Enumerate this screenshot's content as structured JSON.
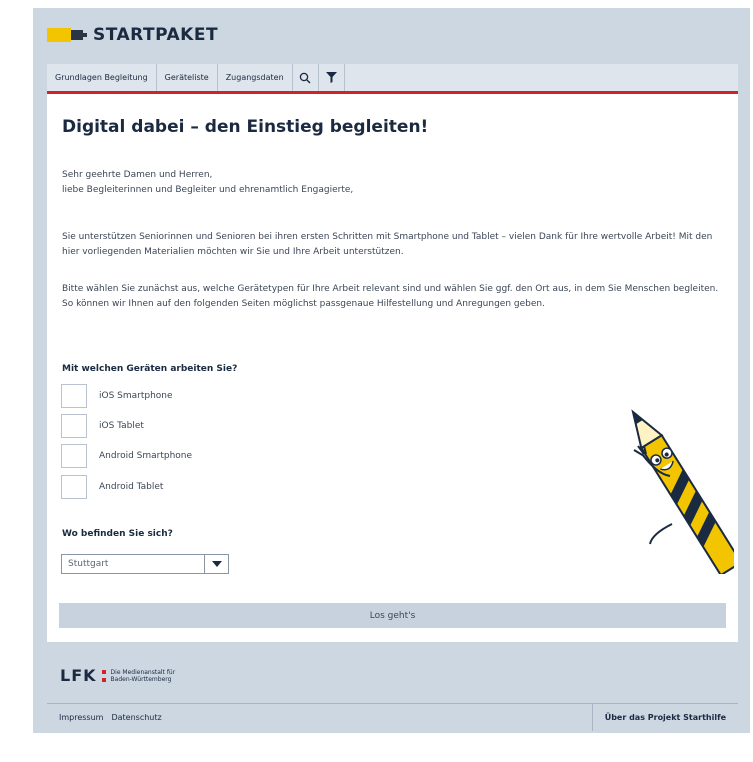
{
  "header": {
    "logo_text": "STARTPAKET"
  },
  "tabs": [
    {
      "label": "Grundlagen Begleitung"
    },
    {
      "label": "Geräteliste"
    },
    {
      "label": "Zugangsdaten"
    }
  ],
  "icons": {
    "search": "search-icon",
    "filter": "filter-icon"
  },
  "main": {
    "title": "Digital dabei – den Einstieg begleiten!",
    "greeting_1": "Sehr geehrte Damen und Herren,",
    "greeting_2": "liebe Begleiterinnen und Begleiter und ehrenamtlich Engagierte,",
    "intro": "Sie unterstützen Seniorinnen und Senioren bei ihren ersten Schritten mit Smartphone und Tablet – vielen Dank für Ihre wertvolle Arbeit! Mit den hier vorliegenden Materialien möchten wir Sie und Ihre Arbeit unterstützen.",
    "instruction": "Bitte wählen Sie zunächst aus, welche Gerätetypen für Ihre Arbeit relevant sind und wählen Sie ggf. den Ort aus, in dem Sie Menschen begleiten. So können wir Ihnen auf den folgenden Seiten möglichst passgenaue Hilfestellung und Anregungen geben.",
    "devices_question": "Mit welchen Geräten arbeiten Sie?",
    "devices": [
      {
        "label": "iOS Smartphone",
        "checked": false
      },
      {
        "label": "iOS Tablet",
        "checked": false
      },
      {
        "label": "Android Smartphone",
        "checked": false
      },
      {
        "label": "Android Tablet",
        "checked": false
      }
    ],
    "location_question": "Wo befinden Sie sich?",
    "location_value": "Stuttgart",
    "submit_label": "Los geht's"
  },
  "footer": {
    "logo_text": "LFK",
    "logo_sub_1": "Die Medienanstalt für",
    "logo_sub_2": "Baden-Württemberg",
    "links": [
      "Impressum",
      "Datenschutz"
    ],
    "right_link": "Über das Projekt Starthilfe"
  },
  "colors": {
    "accent_red": "#d42027",
    "brand_yellow": "#f2c500",
    "frame_blue": "#cdd7e2"
  }
}
